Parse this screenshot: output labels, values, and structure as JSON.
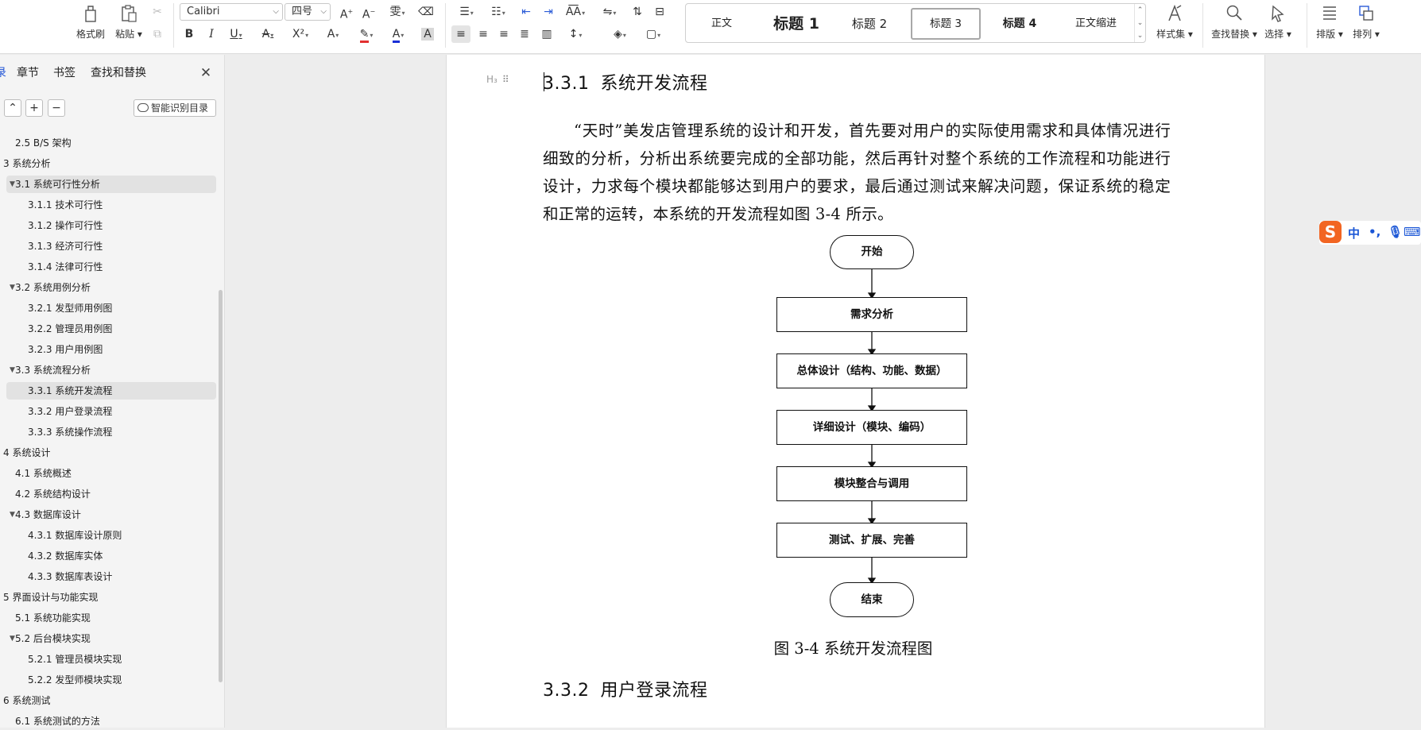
{
  "ribbon": {
    "clipboard": {
      "format_painter": "格式刷",
      "paste": "粘贴"
    },
    "font_name": "Calibri",
    "font_size": "四号",
    "styles": [
      "正文",
      "标题  1",
      "标题  2",
      "标题  3",
      "标题 4",
      "正文缩进"
    ],
    "selected_style_index": 3,
    "style_set": "样式集",
    "find_replace": "查找替换",
    "select": "选择",
    "layout": "排版",
    "arrange": "排列"
  },
  "sidebar": {
    "tabs": [
      "录",
      "章节",
      "书签",
      "查找和替换"
    ],
    "smart_toc_label": "智能识别目录",
    "outline": [
      {
        "text": "2.5 B/S 架构",
        "level": 1,
        "tri": false
      },
      {
        "text": "3 系统分析",
        "level": 0,
        "tri": false
      },
      {
        "text": "3.1  系统可行性分析",
        "level": 1,
        "tri": true,
        "hl": true
      },
      {
        "text": "3.1.1  技术可行性",
        "level": 2,
        "tri": false
      },
      {
        "text": "3.1.2  操作可行性",
        "level": 2,
        "tri": false
      },
      {
        "text": "3.1.3  经济可行性",
        "level": 2,
        "tri": false
      },
      {
        "text": "3.1.4  法律可行性",
        "level": 2,
        "tri": false
      },
      {
        "text": "3.2 系统用例分析",
        "level": 1,
        "tri": true
      },
      {
        "text": "3.2.1 发型师用例图",
        "level": 2,
        "tri": false
      },
      {
        "text": "3.2.2 管理员用例图",
        "level": 2,
        "tri": false
      },
      {
        "text": "3.2.3 用户用例图",
        "level": 2,
        "tri": false
      },
      {
        "text": "3.3 系统流程分析",
        "level": 1,
        "tri": true
      },
      {
        "text": "3.3.1  系统开发流程",
        "level": 2,
        "tri": false,
        "hl": true
      },
      {
        "text": "3.3.2  用户登录流程",
        "level": 2,
        "tri": false
      },
      {
        "text": "3.3.3  系统操作流程",
        "level": 2,
        "tri": false
      },
      {
        "text": "4  系统设计",
        "level": 0,
        "tri": false
      },
      {
        "text": "4.1  系统概述",
        "level": 1,
        "tri": false
      },
      {
        "text": "4.2  系统结构设计",
        "level": 1,
        "tri": false
      },
      {
        "text": "4.3  数据库设计",
        "level": 1,
        "tri": true
      },
      {
        "text": "4.3.1  数据库设计原则",
        "level": 2,
        "tri": false
      },
      {
        "text": "4.3.2  数据库实体",
        "level": 2,
        "tri": false
      },
      {
        "text": "4.3.3  数据库表设计",
        "level": 2,
        "tri": false
      },
      {
        "text": "5 界面设计与功能实现",
        "level": 0,
        "tri": false
      },
      {
        "text": "5.1 系统功能实现",
        "level": 1,
        "tri": false
      },
      {
        "text": "5.2 后台模块实现",
        "level": 1,
        "tri": true
      },
      {
        "text": "5.2.1 管理员模块实现",
        "level": 2,
        "tri": false
      },
      {
        "text": "5.2.2 发型师模块实现",
        "level": 2,
        "tri": false
      },
      {
        "text": "6 系统测试",
        "level": 0,
        "tri": false
      },
      {
        "text": "6.1 系统测试的方法",
        "level": 1,
        "tri": false
      }
    ]
  },
  "document": {
    "heading_marker": "H₃",
    "heading1": {
      "num": "3.3.1",
      "title": "系统开发流程"
    },
    "paragraph": "“天时”美发店管理系统的设计和开发，首先要对用户的实际使用需求和具体情况进行细致的分析，分析出系统要完成的全部功能，然后再针对整个系统的工作流程和功能进行设计，力求每个模块都能够达到用户的要求，最后通过测试来解决问题，保证系统的稳定和正常的运转，本系统的开发流程如图 3-4 所示。",
    "flowchart": [
      "开始",
      "需求分析",
      "总体设计（结构、功能、数据）",
      "详细设计（模块、编码）",
      "模块整合与调用",
      "测试、扩展、完善",
      "结束"
    ],
    "caption": "图 3-4 系统开发流程图",
    "heading2": {
      "num": "3.3.2",
      "title": "用户登录流程"
    }
  },
  "ime": {
    "logo": "S",
    "lang": "中"
  }
}
